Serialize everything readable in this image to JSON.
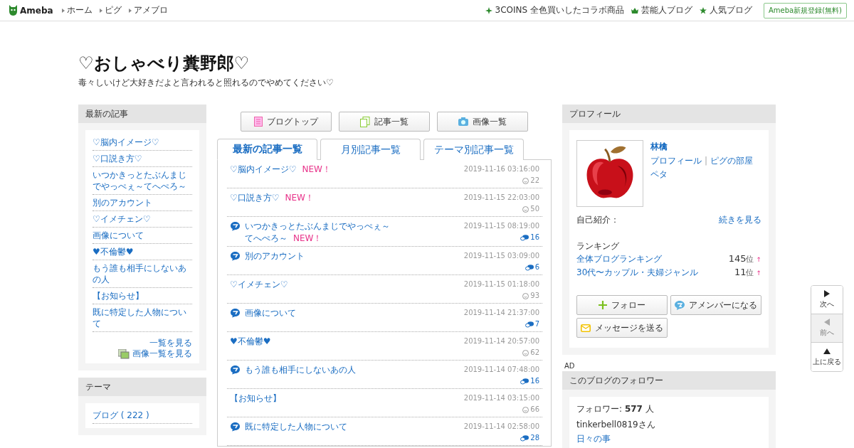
{
  "header": {
    "logo": "Ameba",
    "nav": [
      "ホーム",
      "ピグ",
      "アメブロ"
    ],
    "links": [
      {
        "kind": "sparkle",
        "label": "3COINS 全色買いしたコラボ商品"
      },
      {
        "kind": "crown",
        "label": "芸能人ブログ"
      },
      {
        "kind": "star",
        "label": "人気ブログ"
      }
    ],
    "register": "Ameba新規登録(無料)"
  },
  "blog": {
    "title": "♡おしゃべり糞野郎♡",
    "description": "毒々しいけど大好きだよと言われると照れるのでやめてください♡"
  },
  "recent": {
    "heading": "最新の記事",
    "items": [
      "♡脳内イメージ♡",
      "♡口説き方♡",
      "いつかきっとたぶんまじでやっぺぇ～てへぺろ～",
      "別のアカウント",
      "♡イメチェン♡",
      "画像について",
      "♥不倫鬱♥",
      "もう誰も相手にしないあの人",
      "【お知らせ】",
      "既に特定した人物について"
    ],
    "more": "一覧を見る",
    "images": "画像一覧を見る"
  },
  "theme": {
    "heading": "テーマ",
    "items": [
      "ブログ ( 222 )"
    ]
  },
  "buttons": [
    {
      "kind": "doc",
      "label": "ブログトップ"
    },
    {
      "kind": "pages",
      "label": "記事一覧"
    },
    {
      "kind": "camera",
      "label": "画像一覧"
    }
  ],
  "tabs": [
    {
      "label": "最新の記事一覧",
      "selected": true
    },
    {
      "label": "月別記事一覧",
      "selected": false
    },
    {
      "label": "テーマ別記事一覧",
      "selected": false
    }
  ],
  "articles": [
    {
      "title": "♡脳内イメージ♡",
      "new": "NEW！",
      "amember": false,
      "date": "2019-11-16 03:16:00",
      "comments": false,
      "count": "22"
    },
    {
      "title": "♡口説き方♡",
      "new": "NEW！",
      "amember": false,
      "date": "2019-11-15 22:03:00",
      "comments": false,
      "count": "50"
    },
    {
      "title": "いつかきっとたぶんまじでやっぺぇ～てへぺろ～",
      "new": "NEW！",
      "amember": true,
      "date": "2019-11-15 08:19:00",
      "comments": true,
      "count": "16"
    },
    {
      "title": "別のアカウント",
      "amember": true,
      "date": "2019-11-15 03:09:00",
      "comments": true,
      "count": "6"
    },
    {
      "title": "♡イメチェン♡",
      "amember": false,
      "date": "2019-11-15 01:18:00",
      "comments": false,
      "count": "93"
    },
    {
      "title": "画像について",
      "amember": true,
      "date": "2019-11-14 21:37:00",
      "comments": true,
      "count": "7"
    },
    {
      "title": "♥不倫鬱♥",
      "amember": false,
      "date": "2019-11-14 20:57:00",
      "comments": false,
      "count": "62"
    },
    {
      "title": "もう誰も相手にしないあの人",
      "amember": true,
      "date": "2019-11-14 07:48:00",
      "comments": true,
      "count": "16"
    },
    {
      "title": "【お知らせ】",
      "amember": false,
      "date": "2019-11-14 03:15:00",
      "comments": false,
      "count": "66"
    },
    {
      "title": "既に特定した人物について",
      "amember": true,
      "date": "2019-11-14 02:58:00",
      "comments": true,
      "count": "28"
    }
  ],
  "profile": {
    "heading": "プロフィール",
    "name": "林檎",
    "links": [
      "プロフィール",
      "ピグの部屋"
    ],
    "separator": "|",
    "peta": "ペタ",
    "intro_label": "自己紹介：",
    "intro_more": "続きを見る",
    "ranking_label": "ランキング",
    "rankings": [
      {
        "name": "全体ブログランキング",
        "rank": "145",
        "unit": "位",
        "arrow": "↑"
      },
      {
        "name": "30代〜カップル・夫婦ジャンル",
        "rank": "11",
        "unit": "位",
        "arrow": "↑"
      }
    ],
    "actions": [
      {
        "kind": "follow",
        "label": "フォロー"
      },
      {
        "kind": "amember",
        "label": "アメンバーになる"
      },
      {
        "kind": "message",
        "label": "メッセージを送る"
      }
    ]
  },
  "ad_label": "AD",
  "followers": {
    "heading": "このブログのフォロワー",
    "count_label": "フォロワー:",
    "count": "577",
    "count_unit": "人",
    "user": "tinkerbell0819さん",
    "user_blog": "日々の事"
  },
  "side_nav": [
    {
      "kind": "next",
      "label": "次へ",
      "disabled": false
    },
    {
      "kind": "prev",
      "label": "前へ",
      "disabled": true
    },
    {
      "kind": "top",
      "label": "上に戻る",
      "disabled": false
    }
  ]
}
